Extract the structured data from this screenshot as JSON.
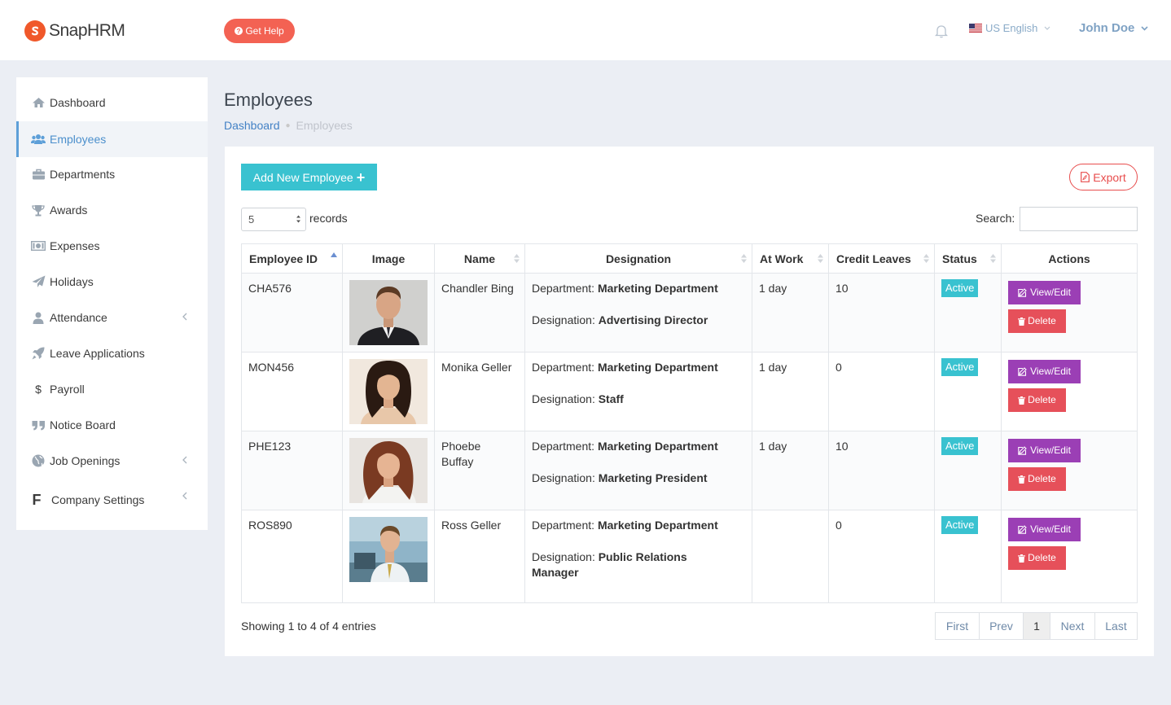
{
  "header": {
    "brand": "SnapHRM",
    "get_help": "Get Help",
    "language": "US English",
    "user": "John Doe"
  },
  "sidebar": {
    "items": [
      {
        "label": "Dashboard",
        "icon": "home-icon"
      },
      {
        "label": "Employees",
        "icon": "users-icon",
        "active": true
      },
      {
        "label": "Departments",
        "icon": "briefcase-icon"
      },
      {
        "label": "Awards",
        "icon": "trophy-icon"
      },
      {
        "label": "Expenses",
        "icon": "money-icon"
      },
      {
        "label": "Holidays",
        "icon": "paper-plane-icon"
      },
      {
        "label": "Attendance",
        "icon": "user-icon",
        "submenu": true
      },
      {
        "label": "Leave Applications",
        "icon": "rocket-icon"
      },
      {
        "label": "Payroll",
        "icon": "dollar-icon"
      },
      {
        "label": "Notice Board",
        "icon": "quote-icon"
      },
      {
        "label": "Job Openings",
        "icon": "globe-icon",
        "submenu": true
      },
      {
        "label": "Company Settings",
        "icon": "letter-f-icon",
        "submenu": true
      }
    ],
    "payroll_symbol": "$",
    "settings_symbol": "F"
  },
  "page": {
    "title": "Employees",
    "breadcrumb": {
      "home": "Dashboard",
      "current": "Employees"
    }
  },
  "toolbar": {
    "add_label": "Add New Employee",
    "add_plus": "+",
    "export_label": "Export",
    "records_value": "5",
    "records_label": "records",
    "search_label": "Search:",
    "search_value": ""
  },
  "table": {
    "columns": [
      "Employee ID",
      "Image",
      "Name",
      "Designation",
      "At Work",
      "Credit Leaves",
      "Status",
      "Actions"
    ],
    "dept_prefix": "Department:",
    "desig_prefix": "Designation:",
    "view_label": "View/Edit",
    "delete_label": "Delete",
    "rows": [
      {
        "id": "CHA576",
        "name": "Chandler Bing",
        "department": "Marketing Department",
        "designation": "Advertising Director",
        "at_work": "1 day",
        "credit_leaves": "10",
        "status": "Active"
      },
      {
        "id": "MON456",
        "name": "Monika Geller",
        "department": "Marketing Department",
        "designation": "Staff",
        "at_work": "1 day",
        "credit_leaves": "0",
        "status": "Active"
      },
      {
        "id": "PHE123",
        "name": "Phoebe Buffay",
        "department": "Marketing Department",
        "designation": "Marketing President",
        "at_work": "1 day",
        "credit_leaves": "10",
        "status": "Active"
      },
      {
        "id": "ROS890",
        "name": "Ross Geller",
        "department": "Marketing Department",
        "designation": "Public Relations Manager",
        "at_work": "",
        "credit_leaves": "0",
        "status": "Active"
      }
    ]
  },
  "footer": {
    "showing": "Showing 1 to 4 of 4 entries",
    "pager": {
      "first": "First",
      "prev": "Prev",
      "current": "1",
      "next": "Next",
      "last": "Last"
    }
  },
  "colors": {
    "accent": "#39c2d0",
    "view_button": "#9b3fb5",
    "delete_button": "#e6505a",
    "help_button": "#f36253",
    "brand": "#f0582a"
  }
}
